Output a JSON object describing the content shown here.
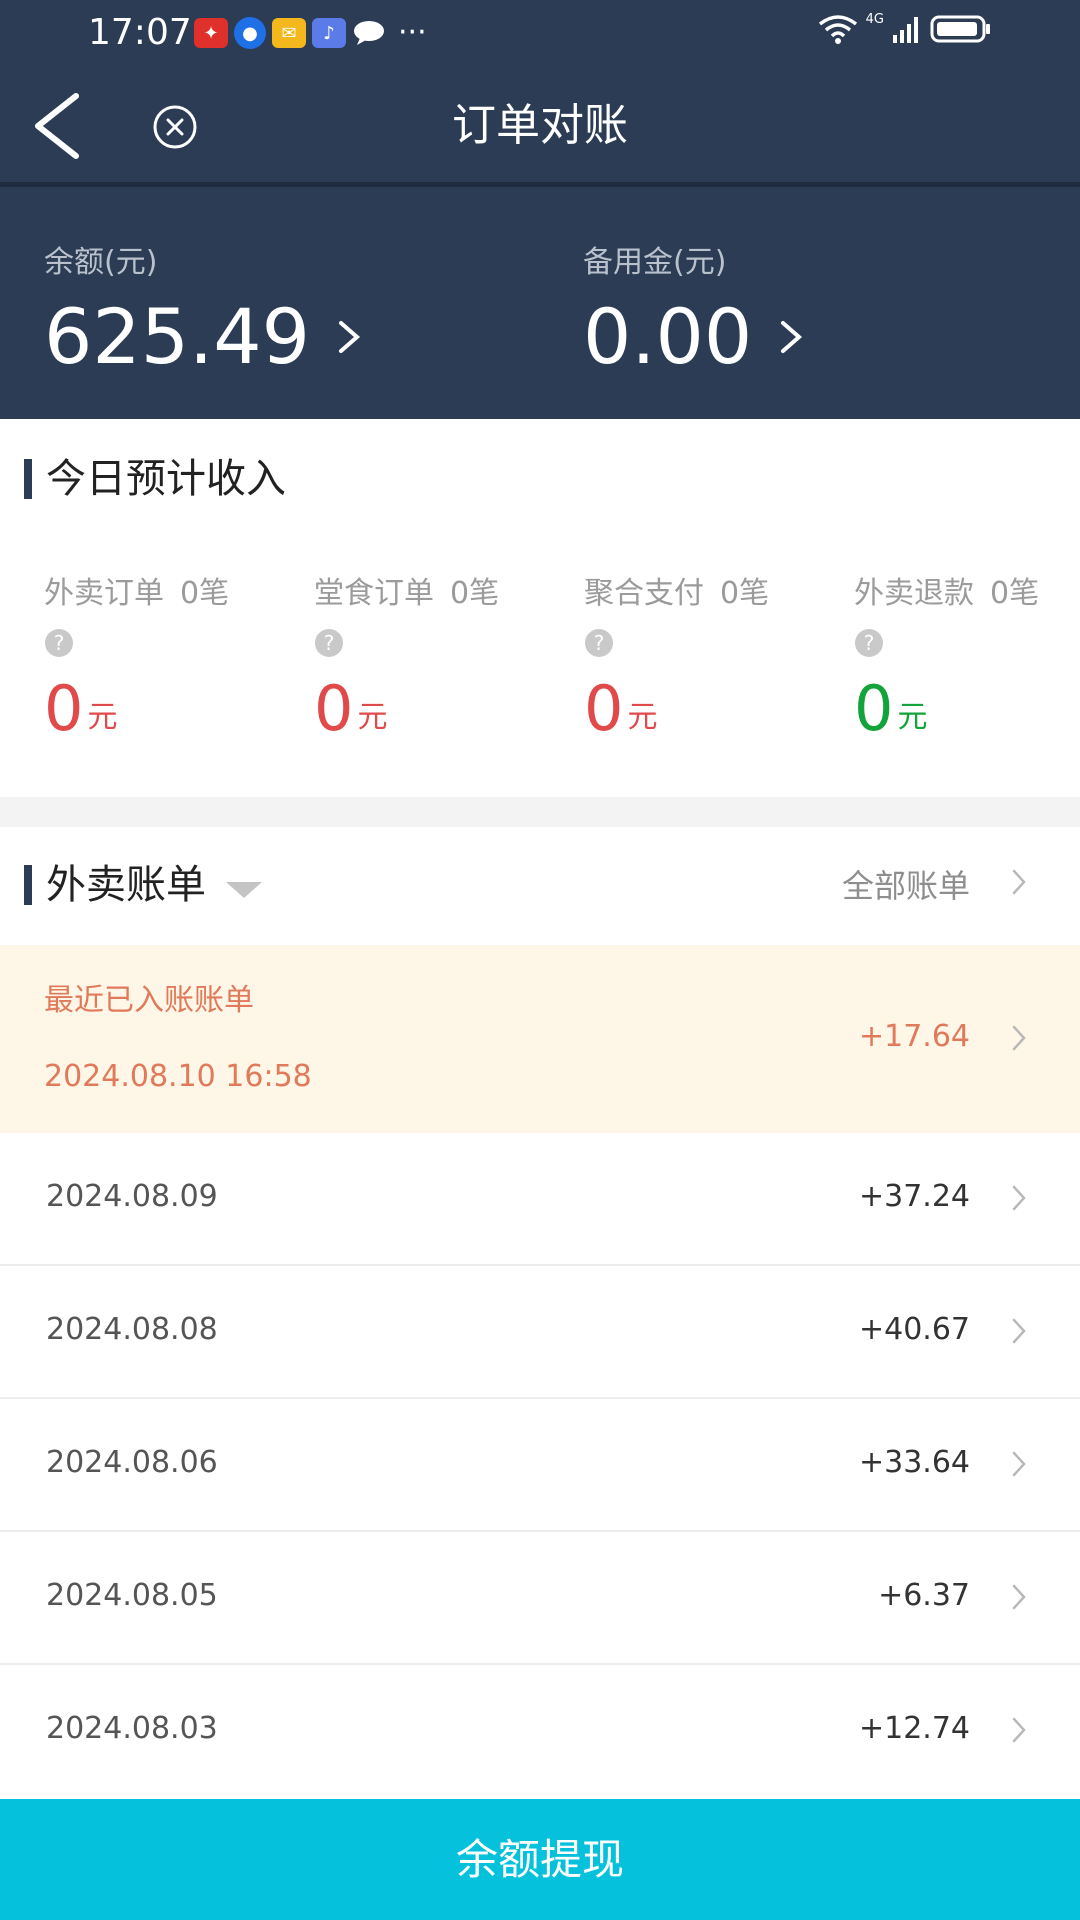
{
  "status_bar": {
    "time": "17:07",
    "network_label": "4G"
  },
  "nav": {
    "title": "订单对账"
  },
  "balance": {
    "label": "余额(元)",
    "value": "625.49"
  },
  "reserve": {
    "label": "备用金(元)",
    "value": "0.00"
  },
  "today_income": {
    "title": "今日预计收入",
    "items": [
      {
        "label": "外卖订单",
        "count": "0笔",
        "amount": "0",
        "unit": "元",
        "color": "#e04a4a"
      },
      {
        "label": "堂食订单",
        "count": "0笔",
        "amount": "0",
        "unit": "元",
        "color": "#e04a4a"
      },
      {
        "label": "聚合支付",
        "count": "0笔",
        "amount": "0",
        "unit": "元",
        "color": "#e04a4a"
      },
      {
        "label": "外卖退款",
        "count": "0笔",
        "amount": "0",
        "unit": "元",
        "color": "#12a33a"
      }
    ]
  },
  "bills": {
    "title": "外卖账单",
    "all_link": "全部账单",
    "latest": {
      "label": "最近已入账账单",
      "date": "2024.08.10 16:58",
      "amount": "+17.64"
    },
    "rows": [
      {
        "date": "2024.08.09",
        "amount": "+37.24"
      },
      {
        "date": "2024.08.08",
        "amount": "+40.67"
      },
      {
        "date": "2024.08.06",
        "amount": "+33.64"
      },
      {
        "date": "2024.08.05",
        "amount": "+6.37"
      },
      {
        "date": "2024.08.03",
        "amount": "+12.74"
      }
    ]
  },
  "withdraw": {
    "label": "余额提现"
  },
  "colors": {
    "header_bg": "#2c3c54",
    "accent_button": "#05c1dc",
    "income_red": "#e04a4a",
    "refund_green": "#12a33a",
    "latest_bg": "#fef6e6",
    "latest_text": "#e07a5a"
  }
}
